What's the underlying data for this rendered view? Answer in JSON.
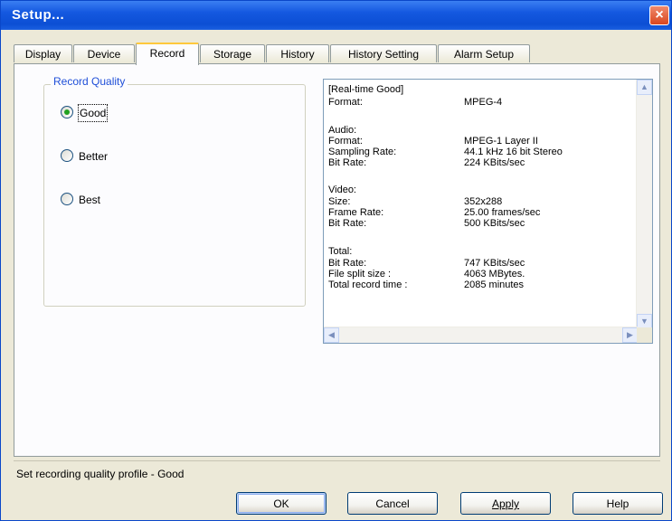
{
  "window": {
    "title": "Setup...",
    "close_glyph": "×"
  },
  "tabs": [
    {
      "label": "Display"
    },
    {
      "label": "Device"
    },
    {
      "label": "Record",
      "active": true
    },
    {
      "label": "Storage"
    },
    {
      "label": "History"
    },
    {
      "label": "History Setting"
    },
    {
      "label": "Alarm Setup"
    }
  ],
  "record_quality": {
    "group_label": "Record Quality",
    "options": [
      {
        "label": "Good",
        "selected": true
      },
      {
        "label": "Better",
        "selected": false
      },
      {
        "label": "Best",
        "selected": false
      }
    ]
  },
  "info": {
    "header": "[Real-time Good]",
    "format_row": {
      "label": "Format:",
      "value": "MPEG-4"
    },
    "audio": {
      "title": "Audio:",
      "rows": [
        {
          "label": "Format:",
          "value": "MPEG-1 Layer II"
        },
        {
          "label": "Sampling Rate:",
          "value": "44.1 kHz 16 bit Stereo"
        },
        {
          "label": "Bit Rate:",
          "value": "224 KBits/sec"
        }
      ]
    },
    "video": {
      "title": "Video:",
      "rows": [
        {
          "label": "Size:",
          "value": "352x288"
        },
        {
          "label": "Frame Rate:",
          "value": "25.00 frames/sec"
        },
        {
          "label": "Bit Rate:",
          "value": "500 KBits/sec"
        }
      ]
    },
    "total": {
      "title": "Total:",
      "rows": [
        {
          "label": "Bit Rate:",
          "value": "747 KBits/sec"
        },
        {
          "label": "File split size :",
          "value": "4063 MBytes."
        },
        {
          "label": "Total record time :",
          "value": "2085 minutes"
        }
      ]
    }
  },
  "status_text": "Set recording quality profile - Good",
  "buttons": {
    "ok": "OK",
    "cancel": "Cancel",
    "apply": "Apply",
    "help": "Help"
  },
  "colors": {
    "title_bar": "#0c4fd4",
    "group_label": "#1f4fd8",
    "radio_selected": "#21a121",
    "active_tab_accent": "#ffc83c"
  }
}
